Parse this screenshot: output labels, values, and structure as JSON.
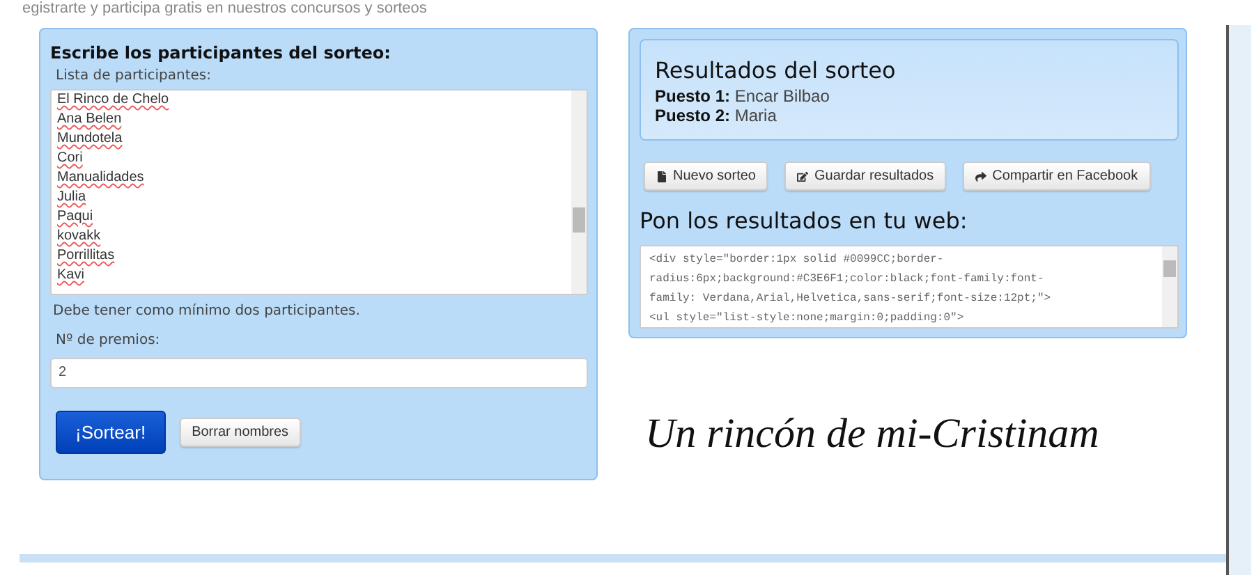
{
  "header_text": "egistrarte y participa gratis en nuestros concursos y sorteos",
  "participants_panel": {
    "title": "Escribe los participantes del sorteo:",
    "list_label": "Lista de participantes:",
    "participants": [
      "El Rinco de Chelo",
      "Ana Belen",
      "Mundotela",
      "Cori",
      "Manualidades",
      "Julia",
      "Paqui",
      "kovakk",
      "Porrillitas",
      "Kavi"
    ],
    "hint": "Debe tener como mínimo dos participantes.",
    "prizes_label": "Nº de premios:",
    "prizes_value": "2",
    "buttons": [
      {
        "label": "¡Sortear!",
        "kind": "primary"
      },
      {
        "label": "Borrar nombres",
        "kind": "default"
      }
    ]
  },
  "results_panel": {
    "title": "Resultados del sorteo",
    "places": [
      {
        "label": "Puesto 1:",
        "name": "Encar Bilbao"
      },
      {
        "label": "Puesto 2:",
        "name": "Maria"
      }
    ],
    "buttons": [
      "Nuevo sorteo",
      "Guardar resultados",
      "Compartir en Facebook"
    ],
    "embed_title": "Pon los resultados en tu web:",
    "embed_code": [
      "<div style=\"border:1px solid #0099CC;border-",
      "radius:6px;background:#C3E6F1;color:black;font-family:font-",
      "family: Verdana,Arial,Helvetica,sans-serif;font-size:12pt;\">",
      "<ul style=\"list-style:none;margin:0;padding:0\">"
    ]
  },
  "signature": "Un rincón de mi-Cristinam"
}
